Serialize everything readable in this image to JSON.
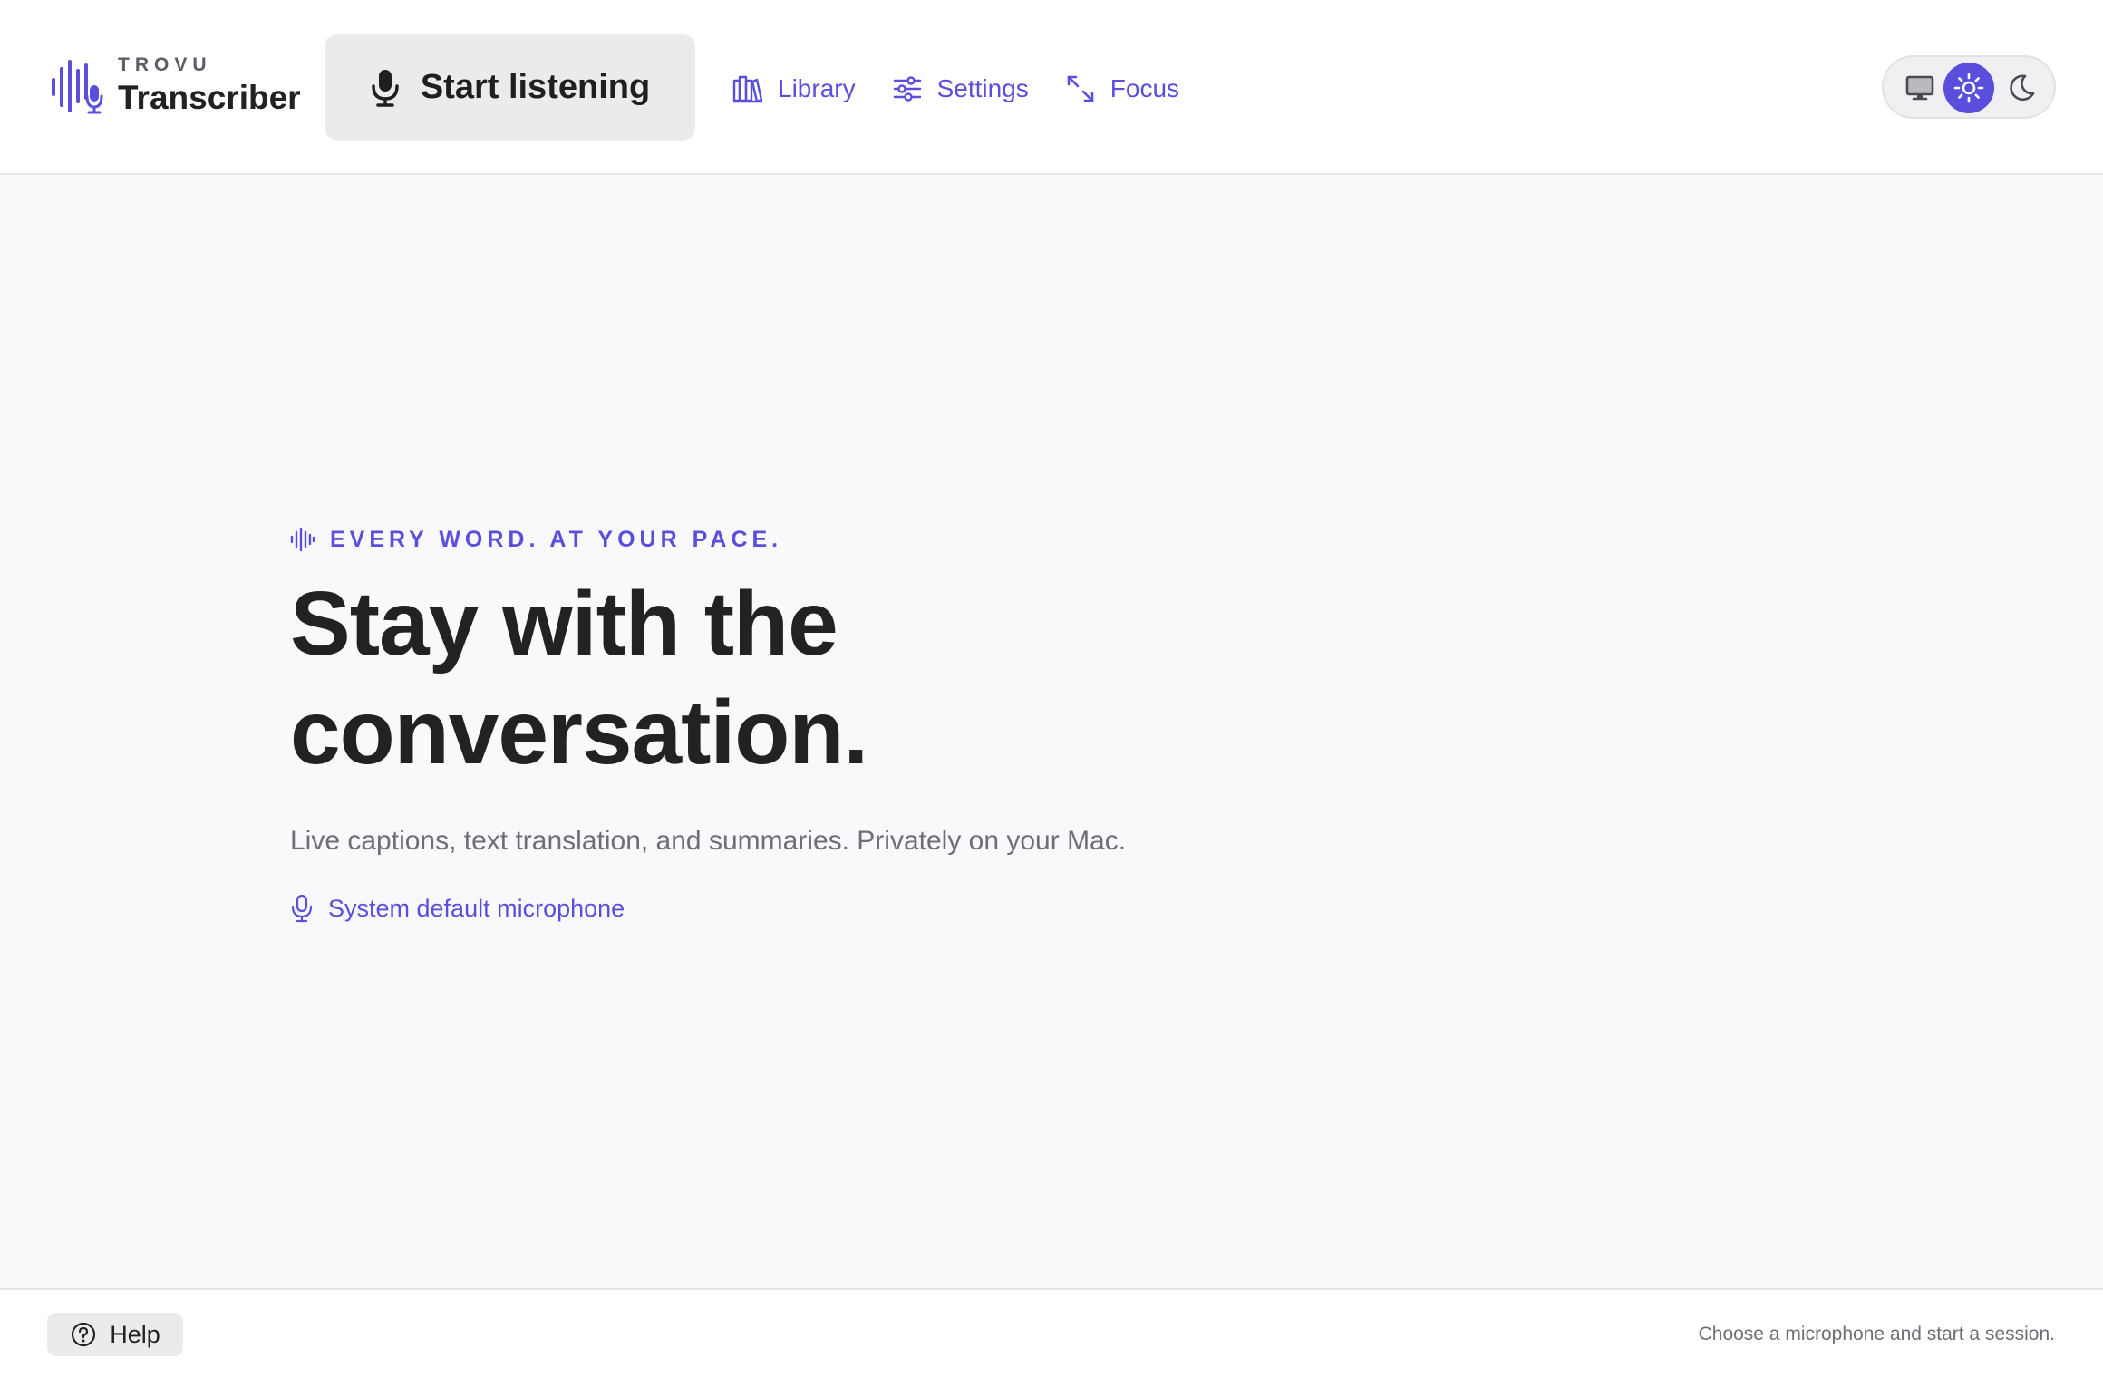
{
  "brand": {
    "small_label": "TROVU",
    "title": "Transcriber",
    "icon": "waveform-mic-icon"
  },
  "header": {
    "start_button_label": "Start listening",
    "start_button_icon": "microphone-icon",
    "nav": [
      {
        "label": "Library",
        "icon": "books-icon"
      },
      {
        "label": "Settings",
        "icon": "sliders-icon"
      },
      {
        "label": "Focus",
        "icon": "expand-arrows-icon"
      }
    ],
    "theme_options": [
      {
        "name": "system",
        "icon": "monitor-icon",
        "active": false
      },
      {
        "name": "light",
        "icon": "sun-icon",
        "active": true
      },
      {
        "name": "dark",
        "icon": "moon-icon",
        "active": false
      }
    ]
  },
  "hero": {
    "eyebrow": "EVERY WORD. AT YOUR PACE.",
    "headline_line1": "Stay with the",
    "headline_line2": "conversation.",
    "subtitle": "Live captions, text translation, and summaries. Privately on your Mac.",
    "microphone_label": "System default microphone"
  },
  "footer": {
    "help_label": "Help",
    "status": "Choose a microphone and start a session."
  },
  "colors": {
    "accent": "#5a4fdc",
    "background": "#f9f9fc",
    "surface": "#ffffff",
    "button_bg": "#ebebeb",
    "text": "#222222",
    "muted": "#6e6e76"
  }
}
